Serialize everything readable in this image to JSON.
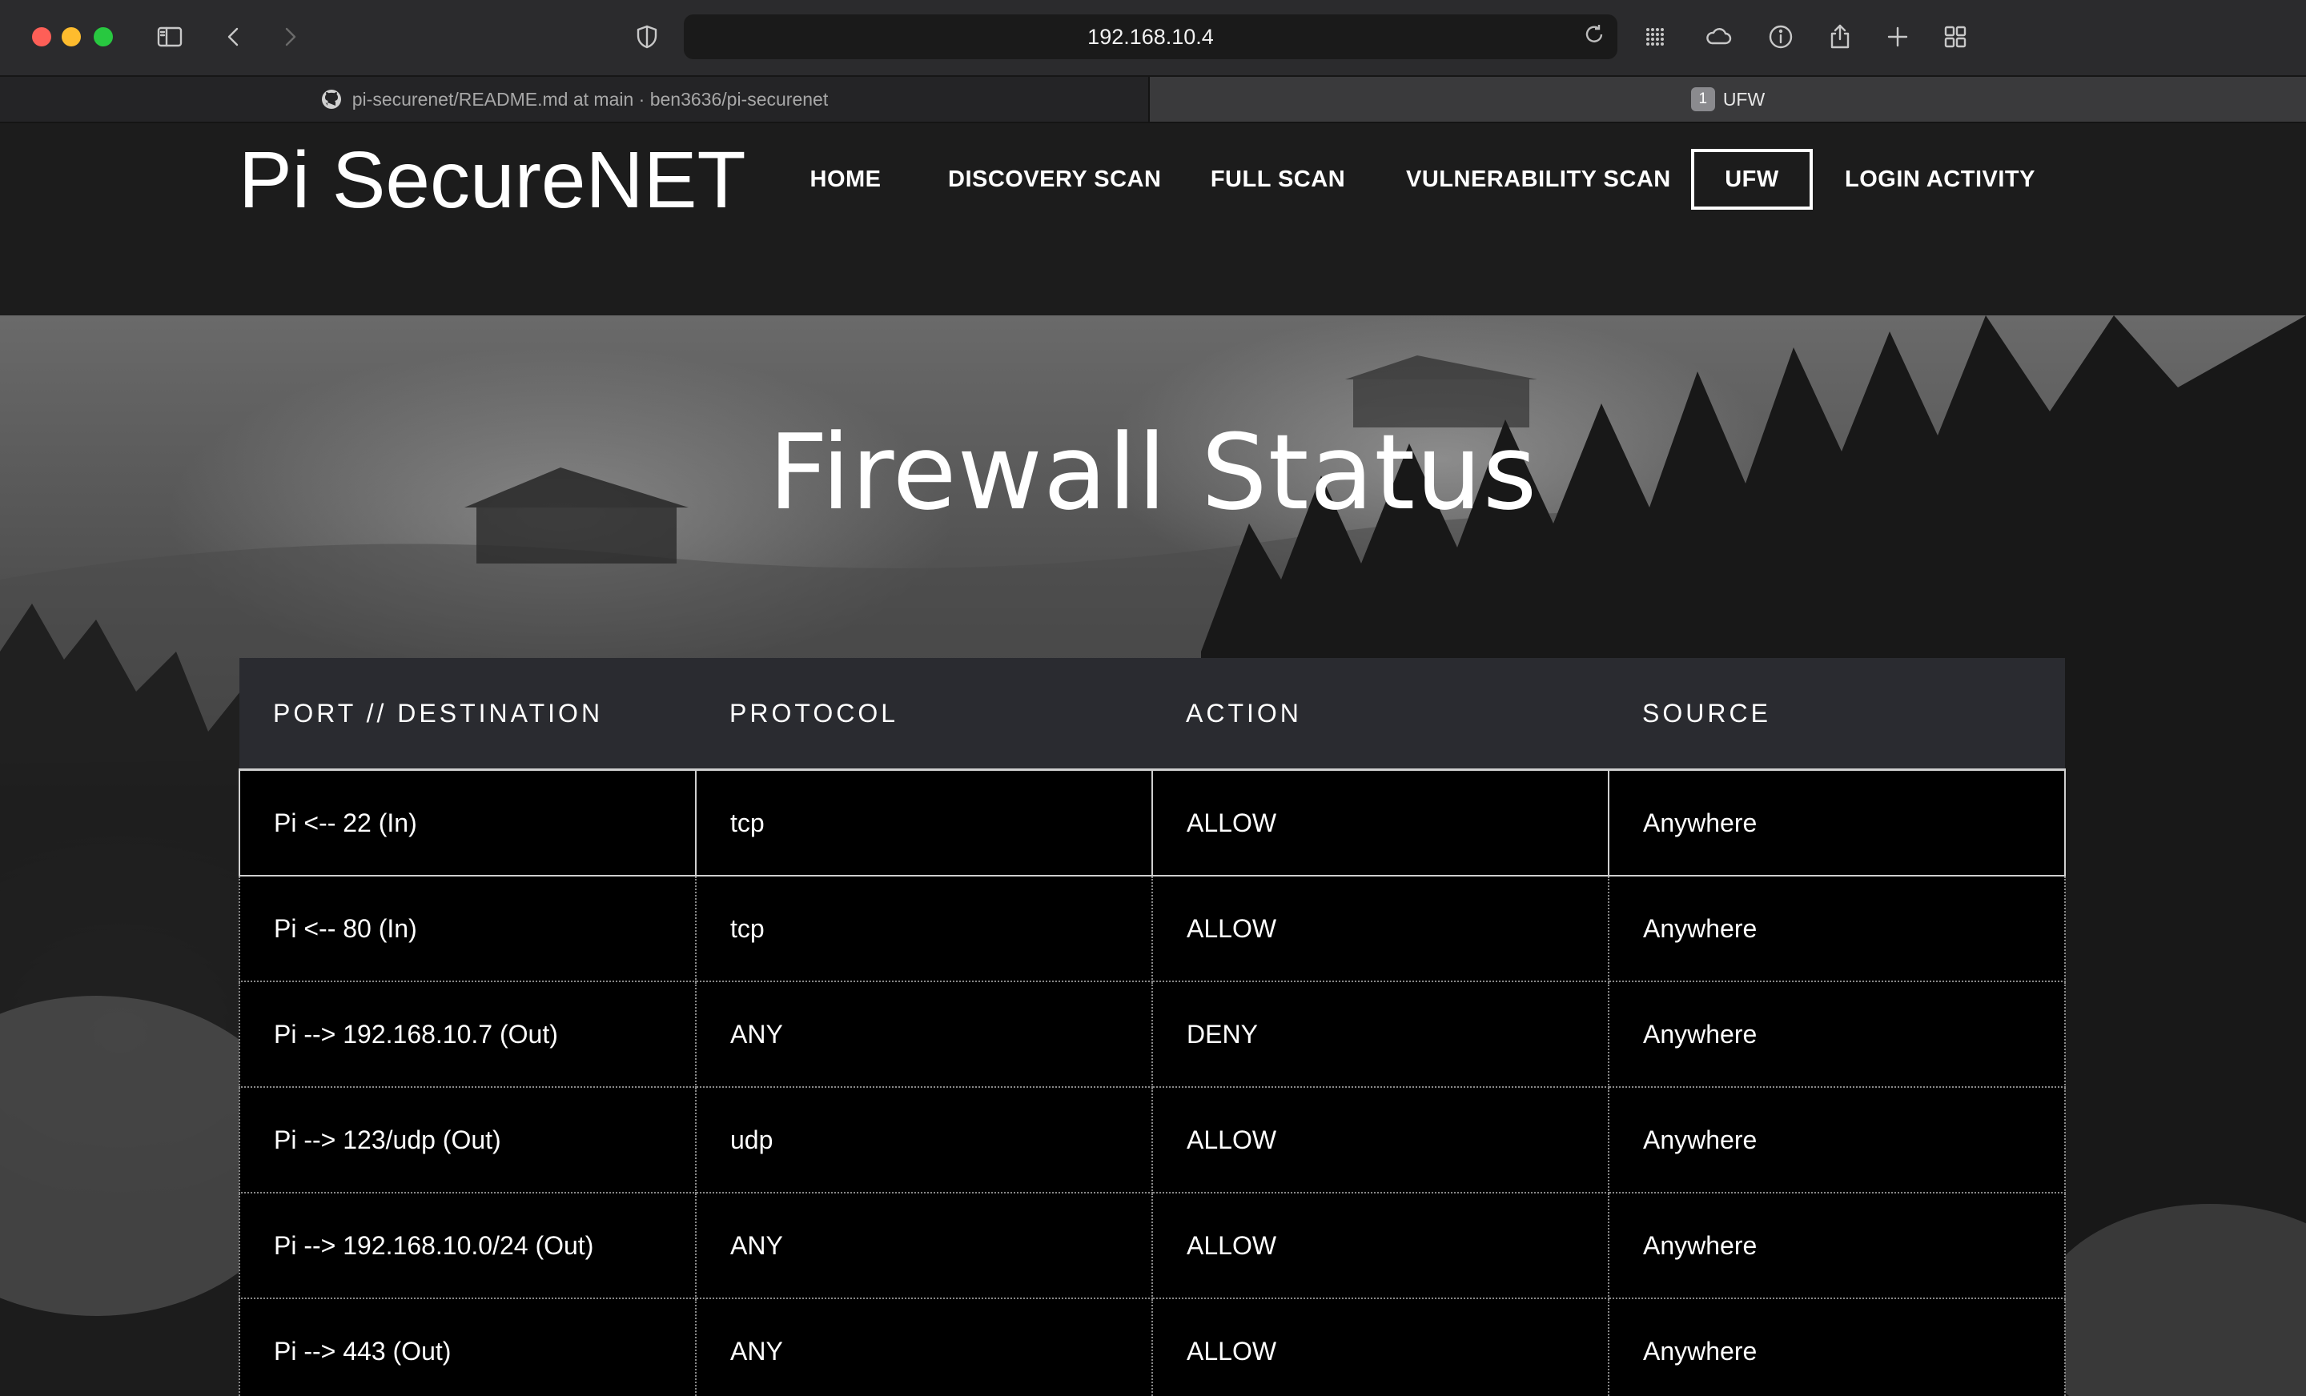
{
  "browser": {
    "url": "192.168.10.4",
    "tabs": [
      {
        "label": "pi-securenet/README.md at main · ben3636/pi-securenet",
        "active": false
      },
      {
        "label": "UFW",
        "badge": "1",
        "active": true
      }
    ]
  },
  "site": {
    "logo": "Pi SecureNET",
    "nav": [
      {
        "label": "HOME"
      },
      {
        "label": "DISCOVERY SCAN"
      },
      {
        "label": "FULL SCAN"
      },
      {
        "label": "VULNERABILITY SCAN"
      },
      {
        "label": "UFW",
        "active": true
      },
      {
        "label": "LOGIN ACTIVITY"
      }
    ]
  },
  "hero": {
    "title": "Firewall Status"
  },
  "table": {
    "headers": [
      "PORT // DESTINATION",
      "PROTOCOL",
      "ACTION",
      "SOURCE"
    ],
    "rows": [
      [
        "Pi <-- 22 (In)",
        "tcp",
        "ALLOW",
        "Anywhere"
      ],
      [
        "Pi <-- 80 (In)",
        "tcp",
        "ALLOW",
        "Anywhere"
      ],
      [
        "Pi --> 192.168.10.7 (Out)",
        "ANY",
        "DENY",
        "Anywhere"
      ],
      [
        "Pi --> 123/udp (Out)",
        "udp",
        "ALLOW",
        "Anywhere"
      ],
      [
        "Pi --> 192.168.10.0/24 (Out)",
        "ANY",
        "ALLOW",
        "Anywhere"
      ],
      [
        "Pi --> 443 (Out)",
        "ANY",
        "ALLOW",
        "Anywhere"
      ]
    ]
  },
  "colors": {
    "header_bg": "#1c1c1c",
    "table_header_bg": "#2a2b30",
    "cell_bg": "#000000"
  }
}
